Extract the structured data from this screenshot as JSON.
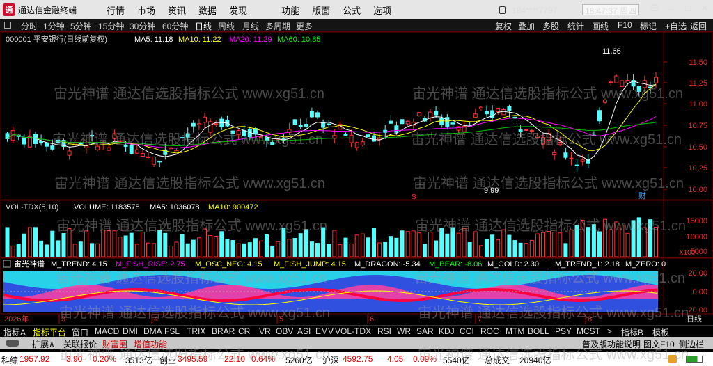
{
  "window": {
    "title": "通达信金融终端",
    "menu": [
      "行情",
      "市场",
      "资讯",
      "数据",
      "发现",
      "功能",
      "版面",
      "公式",
      "选项"
    ],
    "account": "184****7797",
    "clock": "18:47:37 周四",
    "controls": [
      "☰",
      "－",
      "□",
      "✕"
    ]
  },
  "toolbar": {
    "periods": [
      "分时",
      "1分钟",
      "5分钟",
      "15分钟",
      "30分钟",
      "60分钟",
      "日线",
      "周线",
      "月线",
      "多周期",
      "更多"
    ],
    "active": "日线",
    "right": [
      "复权",
      "叠加",
      "多股",
      "统计",
      "画线",
      "F10",
      "标记",
      "+自选",
      "返回"
    ]
  },
  "main_chart": {
    "code_title": "000001 平安银行(日线前复权)",
    "ma5": "MA5: 11.18",
    "ma10": "MA10: 11.22",
    "ma20": "MA20: 11.29",
    "ma60": "MA60: 10.85",
    "y_ticks": [
      "11.50",
      "11.25",
      "11.00",
      "10.75",
      "10.50",
      "10.25",
      "10.00"
    ],
    "high_label": "11.66",
    "low_label": "9.99",
    "marker_s": "S",
    "marker_cai": "财",
    "colors": {
      "up": "#ff3232",
      "down": "#54ffff",
      "ma5": "#ffffff",
      "ma10": "#ffff00",
      "ma20": "#ff00ff",
      "ma60": "#00c000"
    }
  },
  "volume": {
    "title": "VOL-TDX(5,10)",
    "volume": "VOLUME: 1183578",
    "ma5": "MA5: 1036078",
    "ma10": "MA10: 900472",
    "y_ticks": [
      "10000",
      "15000",
      "10000",
      "5000"
    ],
    "unit": "X100"
  },
  "indicator": {
    "title": "宙光神谱",
    "items": [
      "M_TREND: 4.15",
      "M_FISH_RISE: 2.75",
      "M_OSC_NEG: 4.15",
      "M_FISH_JUMP: 4.15",
      "M_DRAGON: -5.34",
      "M_BEAR: -8.06",
      "M_GOLD: 2.30",
      "M_TREND_1: 2.18",
      "M_ZERO: 0"
    ],
    "y_ticks": [
      "20.00",
      "0.00",
      "-20.00"
    ]
  },
  "dates": {
    "year": "2026年",
    "months": [
      "3",
      "4",
      "5",
      "6",
      "7",
      "8"
    ],
    "period": "日线"
  },
  "tabs": {
    "items": [
      "指标A",
      "指标平台",
      "窗口",
      "MACD",
      "DMI",
      "DMA",
      "FSL",
      "TRIX",
      "BRAR",
      "CR",
      "VR",
      "OBV",
      "ASI",
      "EMV",
      "VOL-TDX",
      "RSI",
      "WR",
      "SAR",
      "KDJ",
      "CCI",
      "ROC",
      "MTM",
      "BOLL",
      "PSY",
      "MCST"
    ],
    "right": [
      "指标B",
      "模板"
    ]
  },
  "subbar": {
    "left": [
      "扩展∧",
      "关联报价",
      "财富圈",
      "增值功能"
    ],
    "right": [
      "普及版功能说明",
      "图文F10",
      "侧边栏"
    ]
  },
  "status": {
    "items": [
      "科综",
      "1957.92",
      "3.90",
      "0.20%",
      "3513亿",
      "创业",
      "3495.59",
      "22.10",
      "0.64%",
      "5260亿",
      "沪深",
      "4592.75",
      "4.05",
      "0.09%",
      "5540亿",
      "总成交",
      "20940亿"
    ]
  },
  "watermark": [
    "宙光神谱",
    "通达信选股指标公式",
    "www.xg51.cn"
  ]
}
